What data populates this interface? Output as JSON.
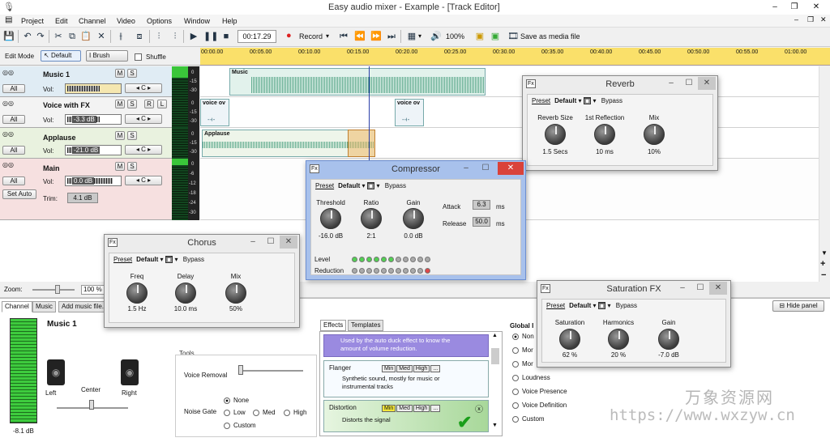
{
  "window": {
    "title": "Easy audio mixer - Example - [Track Editor]"
  },
  "menu": [
    "Project",
    "Edit",
    "Channel",
    "Video",
    "Options",
    "Window",
    "Help"
  ],
  "toolbar": {
    "time": "00:17.29",
    "record_label": "Record",
    "zoom_pct": "100%",
    "save_media_label": "Save as media file"
  },
  "editmode": {
    "label": "Edit Mode",
    "default_label": "Default",
    "brush_label": "Brush",
    "shuffle_label": "Shuffle"
  },
  "ruler": [
    "00:00.00",
    "00:05.00",
    "00:10.00",
    "00:15.00",
    "00:20.00",
    "00:25.00",
    "00:30.00",
    "00:35.00",
    "00:40.00",
    "00:45.00",
    "00:50.00",
    "00:55.00",
    "01:00.00"
  ],
  "tracks": [
    {
      "name": "Music 1",
      "vol_label": "Vol:",
      "vol": "",
      "all_label": "All",
      "pan": "C",
      "m": "M",
      "s": "S"
    },
    {
      "name": "Voice with FX",
      "vol_label": "Vol:",
      "vol": "-3.3 dB",
      "all_label": "All",
      "pan": "C",
      "m": "M",
      "s": "S",
      "r": "R",
      "l": "L"
    },
    {
      "name": "Applause",
      "vol_label": "Vol:",
      "vol": "-21.0 dB",
      "all_label": "All",
      "pan": "C",
      "m": "M",
      "s": "S"
    },
    {
      "name": "Main",
      "vol_label": "Vol:",
      "vol": "0.0 dB",
      "all_label": "All",
      "pan": "C",
      "m": "M",
      "s": "S",
      "setauto": "Set Auto",
      "trim_label": "Trim:",
      "trim": "4.1 dB"
    }
  ],
  "db_scale_small": [
    "0",
    "-15",
    "-30"
  ],
  "db_scale_main": [
    "0",
    "-6",
    "-12",
    "-18",
    "-24",
    "-30"
  ],
  "clips": {
    "music": "Music",
    "voice": "voice ov",
    "voice2": "voice ov",
    "applause": "Applause"
  },
  "zoom": {
    "label": "Zoom:",
    "value": "100 %"
  },
  "bottom_tabs": [
    "Channel",
    "Music",
    "Add music file."
  ],
  "channel": {
    "name": "Music 1",
    "left": "Left",
    "center": "Center",
    "right": "Right",
    "level": "-8.1 dB"
  },
  "tools": {
    "title": "Tools",
    "voice_removal": "Voice Removal",
    "noise_gate": "Noise Gate",
    "none": "None",
    "low": "Low",
    "med": "Med",
    "high": "High",
    "custom": "Custom"
  },
  "effects": {
    "tabs": [
      "Effects",
      "Templates"
    ],
    "note": "Used by the auto duck effect to know the amount of volume reduction.",
    "flanger": {
      "name": "Flanger",
      "desc": "Synthetic sound, mostly for music or instrumental tracks"
    },
    "distortion": {
      "name": "Distortion",
      "desc": "Distorts the signal"
    },
    "levels": [
      "Min",
      "Med",
      "High",
      "..."
    ]
  },
  "global": {
    "title": "Global I",
    "items": [
      "Non",
      "Mor",
      "Mor",
      "Loudness",
      "Voice Presence",
      "Voice Definition",
      "Custom"
    ]
  },
  "hide_panel": "Hide panel",
  "reverb": {
    "title": "Reverb",
    "preset": "Preset",
    "default": "Default",
    "bypass": "Bypass",
    "knobs": [
      {
        "label": "Reverb Size",
        "value": "1.5 Secs"
      },
      {
        "label": "1st Reflection",
        "value": "10 ms"
      },
      {
        "label": "Mix",
        "value": "10%"
      }
    ]
  },
  "compressor": {
    "title": "Compressor",
    "preset": "Preset",
    "default": "Default",
    "bypass": "Bypass",
    "knobs": [
      {
        "label": "Threshold",
        "value": "-16.0 dB"
      },
      {
        "label": "Ratio",
        "value": "2:1"
      },
      {
        "label": "Gain",
        "value": "0.0 dB"
      }
    ],
    "attack_label": "Attack",
    "attack": "6.3",
    "release_label": "Release",
    "release": "50.0",
    "ms": "ms",
    "level_label": "Level",
    "reduction_label": "Reduction"
  },
  "chorus": {
    "title": "Chorus",
    "preset": "Preset",
    "default": "Default",
    "bypass": "Bypass",
    "knobs": [
      {
        "label": "Freq",
        "value": "1.5 Hz"
      },
      {
        "label": "Delay",
        "value": "10.0 ms"
      },
      {
        "label": "Mix",
        "value": "50%"
      }
    ]
  },
  "saturation": {
    "title": "Saturation FX",
    "preset": "Preset",
    "default": "Default",
    "bypass": "Bypass",
    "knobs": [
      {
        "label": "Saturation",
        "value": "62 %"
      },
      {
        "label": "Harmonics",
        "value": "20 %"
      },
      {
        "label": "Gain",
        "value": "-7.0 dB"
      }
    ]
  },
  "watermark": {
    "cn": "万象资源网",
    "url": "https://www.wxzyw.cn"
  }
}
